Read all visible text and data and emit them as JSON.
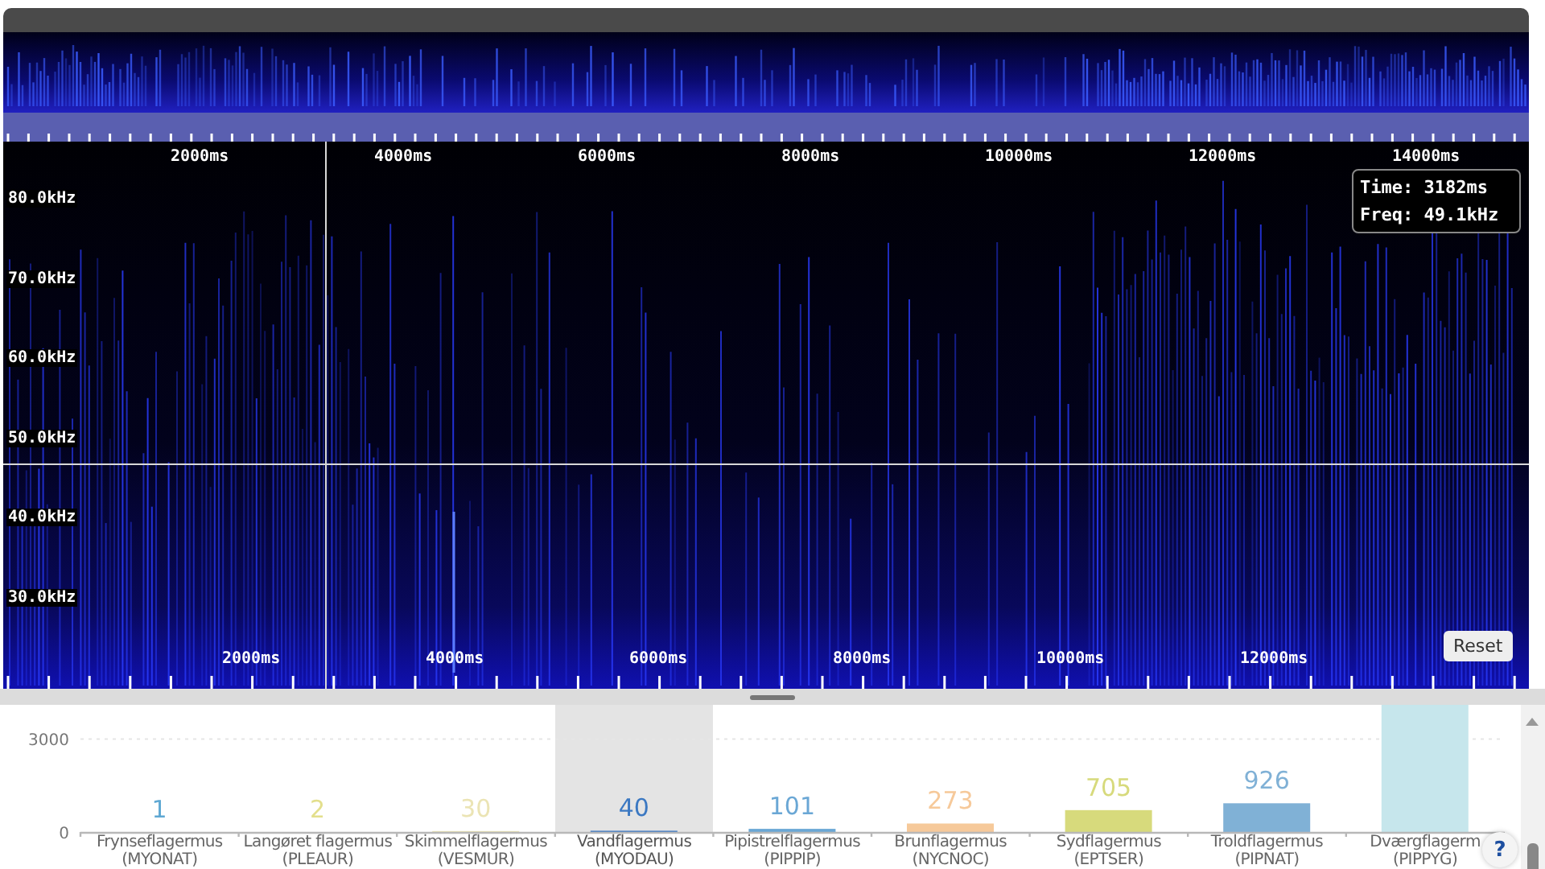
{
  "spectrogram": {
    "time_labels_top": [
      "2000ms",
      "4000ms",
      "6000ms",
      "8000ms",
      "10000ms",
      "12000ms",
      "14000ms"
    ],
    "time_labels_bottom": [
      "2000ms",
      "4000ms",
      "6000ms",
      "8000ms",
      "10000ms",
      "12000ms"
    ],
    "freq_labels": [
      "80.0kHz",
      "70.0kHz",
      "60.0kHz",
      "50.0kHz",
      "40.0kHz",
      "30.0kHz"
    ],
    "tooltip": {
      "time": "Time: 3182ms",
      "freq": "Freq: 49.1kHz"
    },
    "reset_button": "Reset"
  },
  "species_chart": {
    "columns": [
      {
        "hovered": false
      },
      {
        "hovered": false
      },
      {
        "hovered": false
      },
      {
        "hovered": true
      },
      {
        "hovered": false
      },
      {
        "hovered": false
      },
      {
        "hovered": false
      },
      {
        "hovered": false
      },
      {
        "hovered": false
      }
    ],
    "chart_data": {
      "type": "bar",
      "categories": [
        "Frynseflagermus\n(MYONAT)",
        "Langøret flagermus\n(PLEAUR)",
        "Skimmelflagermus\n(VESMUR)",
        "Vandflagermus\n(MYODAU)",
        "Pipistrelflagermus\n(PIPPIP)",
        "Brunflagermus\n(NYCNOC)",
        "Sydflagermus\n(EPTSER)",
        "Troldflagermus\n(PIPNAT)",
        "Dværgflagerm\n(PIPPYG)"
      ],
      "values": [
        1,
        2,
        30,
        40,
        101,
        273,
        705,
        926,
        4100
      ],
      "value_labels": [
        "1",
        "2",
        "30",
        "40",
        "101",
        "273",
        "705",
        "926",
        null
      ],
      "colors": [
        "#5fa8d3",
        "#e3df8c",
        "#ebe4b4",
        "#3b78c2",
        "#6aa7d5",
        "#f6c99a",
        "#d7da7c",
        "#80b1d6",
        "#c6e6ec"
      ],
      "yticks": [
        0,
        3000
      ],
      "ylim": [
        0,
        4100
      ]
    }
  },
  "help_button": "?"
}
